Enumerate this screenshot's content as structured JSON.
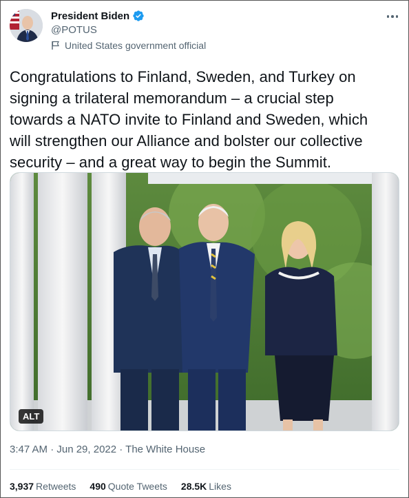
{
  "author": {
    "display_name": "President Biden",
    "handle": "@POTUS",
    "label": "United States government official"
  },
  "tweet": {
    "text_lines": [
      "Congratulations to Finland, Sweden, and Turkey on",
      "signing a trilateral memorandum – a crucial step",
      "towards a NATO invite to Finland and Sweden, which",
      "will strengthen our Alliance and bolster our collective",
      "security – and a great way to begin the Summit."
    ],
    "alt_badge": "ALT",
    "meta": "3:47 AM · Jun 29, 2022 · The White House"
  },
  "stats": {
    "retweets_count": "3,937",
    "retweets_label": "Retweets",
    "quotes_count": "490",
    "quotes_label": "Quote Tweets",
    "likes_count": "28.5K",
    "likes_label": "Likes"
  },
  "colors": {
    "verified": "#1d9bf0",
    "secondary_text": "#536471",
    "primary_text": "#0f1419"
  },
  "icons": [
    "verified-badge-icon",
    "government-flag-icon",
    "more-options-icon"
  ]
}
